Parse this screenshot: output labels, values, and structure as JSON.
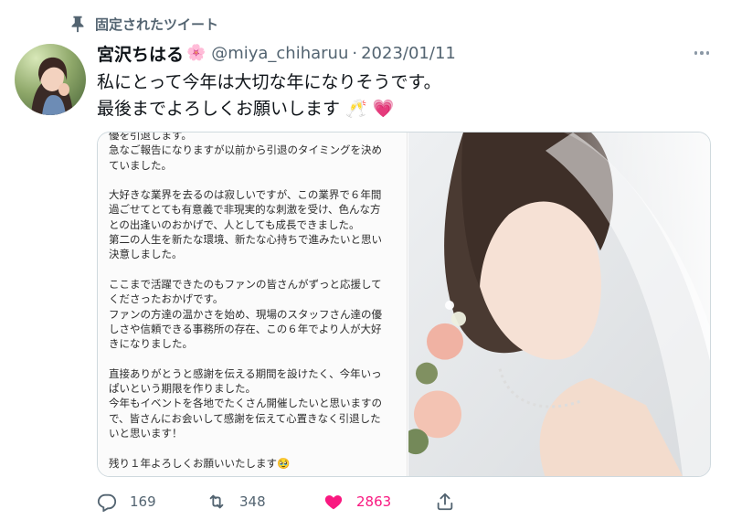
{
  "pinned": {
    "icon": "pin-icon",
    "label": "固定されたツイート"
  },
  "author": {
    "display_name": "宮沢ちはる",
    "name_emoji": "🌸",
    "handle": "@miya_chiharuu",
    "separator": "·",
    "date": "2023/01/11"
  },
  "tweet": {
    "lines": [
      "私にとって今年は大切な年になりそうです。",
      "最後までよろしくお願いします 🥂 💗"
    ]
  },
  "media_text": {
    "lines": [
      "優を引退します。",
      "急なご報告になりますが以前から引退のタイミングを決め",
      "ていました。",
      "",
      "大好きな業界を去るのは寂しいですが、この業界で６年間",
      "過ごせてとても有意義で非現実的な刺激を受け、色んな方",
      "との出逢いのおかげで、人としても成長できました。",
      "第二の人生を新たな環境、新たな心持ちで進みたいと思い",
      "決意しました。",
      "",
      "ここまで活躍できたのもファンの皆さんがずっと応援して",
      "くださったおかげです。",
      "ファンの方達の温かさを始め、現場のスタッフさん達の優",
      "しさや信頼できる事務所の存在、この６年でより人が大好",
      "きになりました。",
      "",
      "直接ありがとうと感謝を伝える期間を設けたく、今年いっ",
      "ぱいという期限を作りました。",
      "今年もイベントを各地でたくさん開催したいと思いますの",
      "で、皆さんにお会いして感謝を伝えて心置きなく引退した",
      "いと思います！",
      "",
      "残り１年よろしくお願いいたします🥹"
    ]
  },
  "actions": {
    "reply": {
      "icon": "reply-icon",
      "count": "169"
    },
    "retweet": {
      "icon": "retweet-icon",
      "count": "348"
    },
    "like": {
      "icon": "heart-icon",
      "count": "2863",
      "color": "#f91880"
    },
    "share": {
      "icon": "share-icon"
    }
  },
  "colors": {
    "text": "#0f1419",
    "secondary": "#536471",
    "border": "#cfd9de",
    "like": "#f91880"
  }
}
